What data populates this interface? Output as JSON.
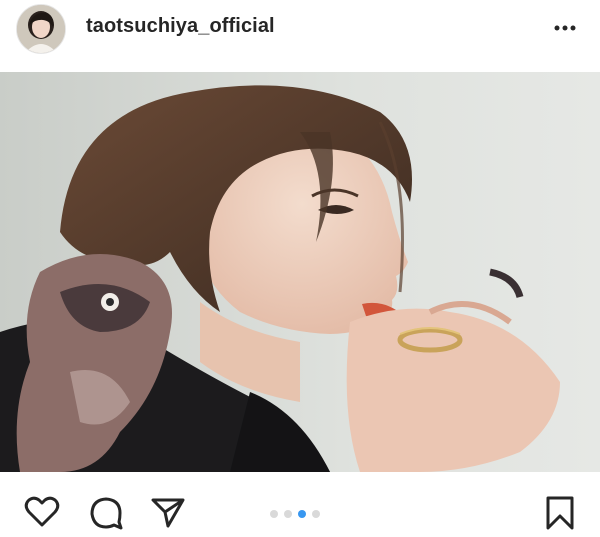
{
  "header": {
    "username": "taotsuchiya_official",
    "avatar_icon": "profile-avatar",
    "more_icon": "more-options-icon"
  },
  "post": {
    "image_description": "",
    "carousel": {
      "count": 4,
      "active_index": 2
    }
  },
  "actions": {
    "like_icon": "heart-icon",
    "comment_icon": "comment-icon",
    "share_icon": "send-icon",
    "save_icon": "bookmark-icon"
  },
  "colors": {
    "text": "#262626",
    "active_dot": "#3897f0",
    "inactive_dot": "#d9d9d9"
  }
}
